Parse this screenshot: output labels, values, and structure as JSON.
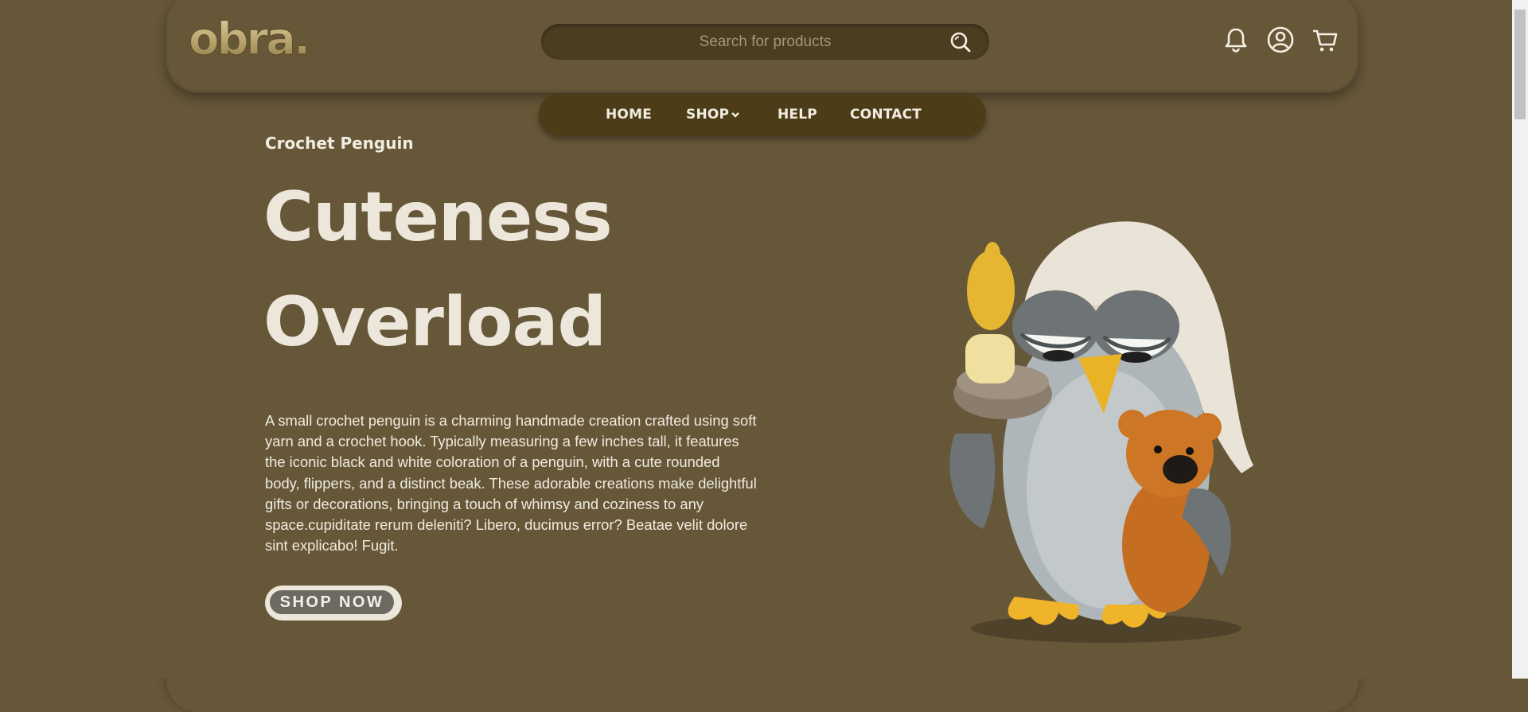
{
  "header": {
    "logo_text": "obra.",
    "search": {
      "placeholder": "Search for products",
      "value": ""
    },
    "icons": [
      "bell-icon",
      "user-icon",
      "cart-icon"
    ]
  },
  "nav": {
    "items": [
      {
        "label": "HOME"
      },
      {
        "label": "SHOP",
        "has_dropdown": true
      },
      {
        "label": "HELP"
      },
      {
        "label": "CONTACT"
      }
    ]
  },
  "hero": {
    "eyebrow": "Crochet Penguin",
    "headline_line1": "Cuteness",
    "headline_line2": "Overload",
    "description": "A small crochet penguin is a charming handmade creation crafted using soft yarn and a crochet hook. Typically measuring a few inches tall, it features the iconic black and white coloration of a penguin, with a cute rounded body, flippers, and a distinct beak. These adorable creations make delightful gifts or decorations, bringing a touch of whimsy and coziness to any space.cupiditate rerum deleniti? Libero, ducimus error? Beatae velit dolore sint explicabo! Fugit.",
    "cta_label": "SHOP NOW"
  },
  "colors": {
    "background": "#665739",
    "search_bg": "#4a3d20",
    "nav_bg": "#4c3d18",
    "text_light": "#ece6db",
    "logo_gold": "#c8b47a"
  }
}
